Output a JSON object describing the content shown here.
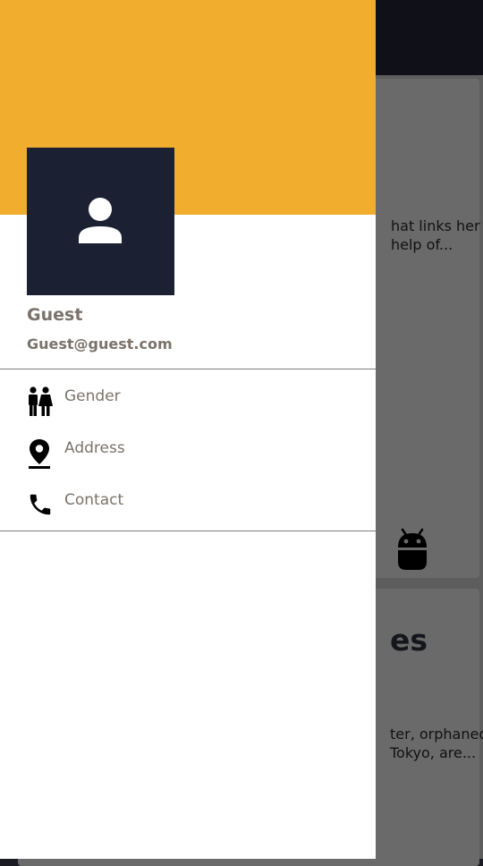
{
  "background": {
    "card1_line1": "hat links her",
    "card1_line2": "help of...",
    "card2_title": "es",
    "card2_line1": "ter, orphaned",
    "card2_line2": "Tokyo, are..."
  },
  "drawer": {
    "header_color": "#f1ad2d",
    "avatar_icon": "person-icon",
    "user": {
      "name": "Guest",
      "email": "Guest@guest.com"
    },
    "menu": [
      {
        "label": "Gender",
        "icon": "gender-icon"
      },
      {
        "label": "Address",
        "icon": "location-pin-icon"
      },
      {
        "label": "Contact",
        "icon": "phone-icon"
      }
    ]
  }
}
